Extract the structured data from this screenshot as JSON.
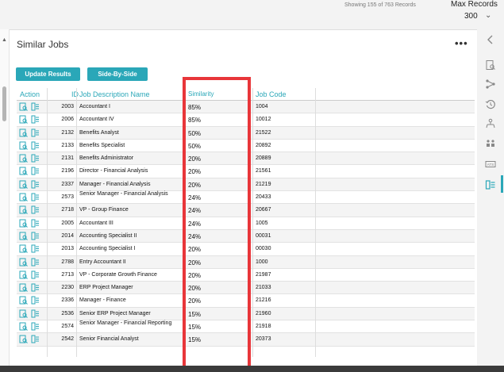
{
  "topbar": {
    "showing": "Showing 155 of 763 Records",
    "max_records_label": "Max Records",
    "max_records_value": "300"
  },
  "panel": {
    "title": "Similar Jobs",
    "more": "•••",
    "buttons": {
      "update": "Update Results",
      "side": "Side-By-Side"
    }
  },
  "table": {
    "headers": {
      "action": "Action",
      "id": "ID",
      "name": "Job Description Name",
      "similarity": "Similarity",
      "code": "Job Code"
    },
    "rows": [
      {
        "id": "2003",
        "name": "Accountant I",
        "similarity": "85%",
        "code": "1004"
      },
      {
        "id": "2006",
        "name": "Accountant IV",
        "similarity": "85%",
        "code": "10012"
      },
      {
        "id": "2132",
        "name": "Benefits Analyst",
        "similarity": "50%",
        "code": "21522"
      },
      {
        "id": "2133",
        "name": "Benefits Specialist",
        "similarity": "50%",
        "code": "20892"
      },
      {
        "id": "2131",
        "name": "Benefits Administrator",
        "similarity": "20%",
        "code": "20889"
      },
      {
        "id": "2196",
        "name": "Director - Financial Analysis",
        "similarity": "20%",
        "code": "21561"
      },
      {
        "id": "2337",
        "name": "Manager - Financial Analysis",
        "similarity": "20%",
        "code": "21219"
      },
      {
        "id": "2573",
        "name": "Senior Manager - Financial Analysis",
        "similarity": "24%",
        "code": "20433"
      },
      {
        "id": "2718",
        "name": "VP - Group Finance",
        "similarity": "24%",
        "code": "20667"
      },
      {
        "id": "2005",
        "name": "Accountant III",
        "similarity": "24%",
        "code": "1005"
      },
      {
        "id": "2014",
        "name": "Accounting Specialist II",
        "similarity": "24%",
        "code": "00031"
      },
      {
        "id": "2013",
        "name": "Accounting Specialist I",
        "similarity": "20%",
        "code": "00030"
      },
      {
        "id": "2788",
        "name": "Entry Accountant II",
        "similarity": "20%",
        "code": "1000"
      },
      {
        "id": "2713",
        "name": "VP - Corporate Growth Finance",
        "similarity": "20%",
        "code": "21987"
      },
      {
        "id": "2230",
        "name": "ERP Project Manager",
        "similarity": "20%",
        "code": "21033"
      },
      {
        "id": "2336",
        "name": "Manager - Finance",
        "similarity": "20%",
        "code": "21216"
      },
      {
        "id": "2536",
        "name": "Senior ERP Project Manager",
        "similarity": "15%",
        "code": "21960"
      },
      {
        "id": "2574",
        "name": "Senior Manager - Financial Reporting",
        "similarity": "15%",
        "code": "21918"
      },
      {
        "id": "2542",
        "name": "Senior Financial Analyst",
        "similarity": "15%",
        "code": "20373"
      }
    ]
  },
  "icons": {
    "row_actions": [
      "view-document-icon",
      "compare-icon"
    ],
    "rightbar": [
      "collapse-left-icon",
      "document-search-icon",
      "network-icon",
      "history-icon",
      "org-chart-icon",
      "group-icon",
      "ats-icon",
      "similar-jobs-icon"
    ],
    "rightbar_ats_text": "ATS"
  },
  "colors": {
    "accent": "#2aa7b8",
    "highlight": "#e8363a"
  }
}
